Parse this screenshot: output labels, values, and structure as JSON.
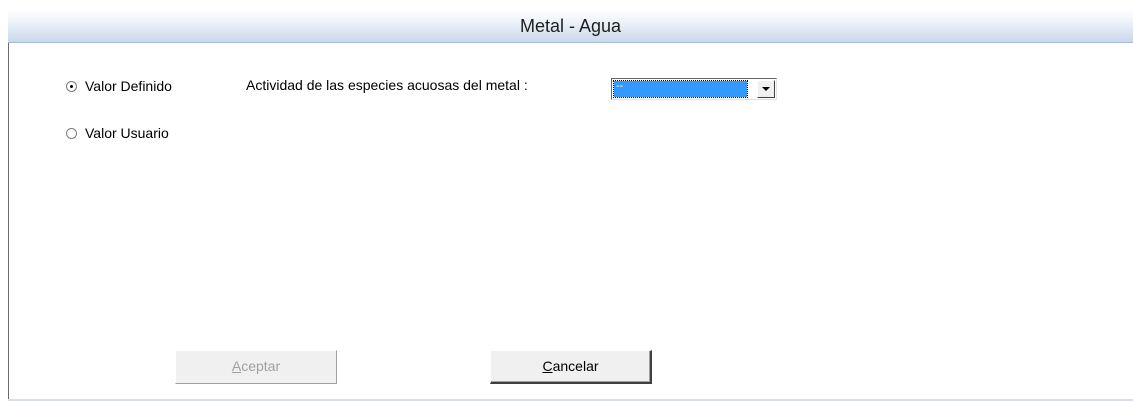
{
  "dialog": {
    "title": "Metal - Agua"
  },
  "options": {
    "defined_label": "Valor Definido",
    "user_label": "Valor Usuario",
    "selected": "defined"
  },
  "activity": {
    "label": "Actividad de las especies acuosas del metal :",
    "selected_value": "--"
  },
  "buttons": {
    "accept_mnemonic": "A",
    "accept_rest": "ceptar",
    "accept_enabled": false,
    "cancel_mnemonic": "C",
    "cancel_rest": "ancelar",
    "cancel_enabled": true
  },
  "colors": {
    "selection": "#3399ff",
    "title_gradient_end": "#c9d8ec"
  }
}
